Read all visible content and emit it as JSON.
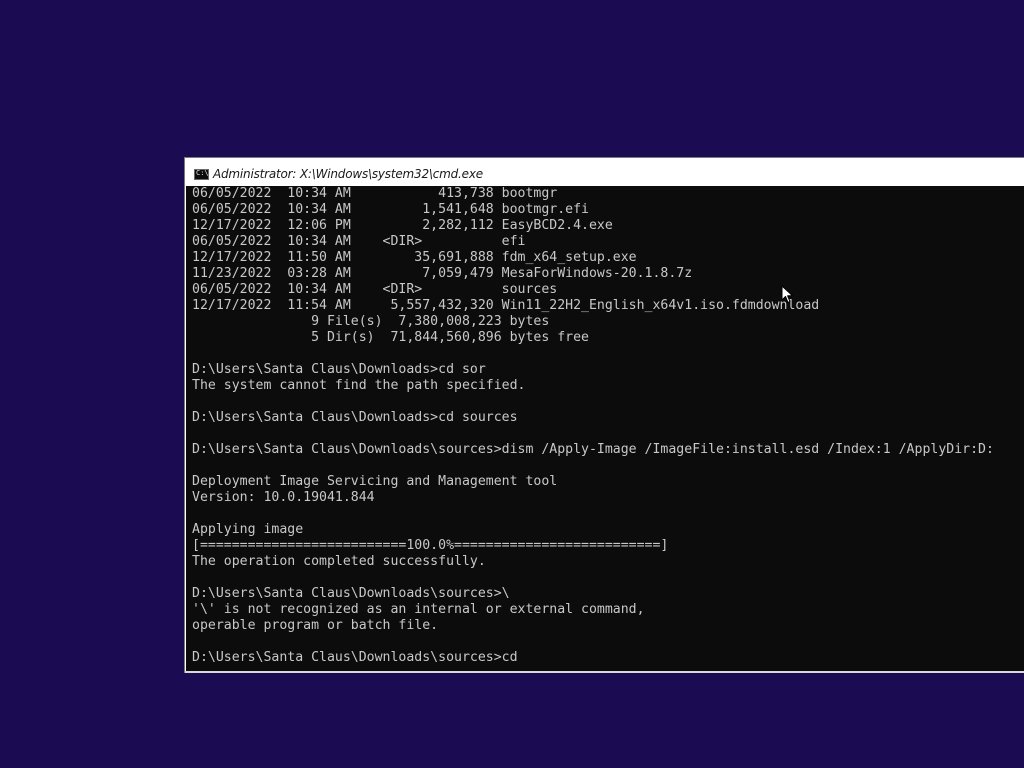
{
  "window": {
    "title": "Administrator: X:\\Windows\\system32\\cmd.exe",
    "icon": "cmd-icon",
    "icon_glyph": "C:\\"
  },
  "console": {
    "lines": [
      "06/05/2022  10:34 AM           413,738 bootmgr",
      "06/05/2022  10:34 AM         1,541,648 bootmgr.efi",
      "12/17/2022  12:06 PM         2,282,112 EasyBCD2.4.exe",
      "06/05/2022  10:34 AM    <DIR>          efi",
      "12/17/2022  11:50 AM        35,691,888 fdm_x64_setup.exe",
      "11/23/2022  03:28 AM         7,059,479 MesaForWindows-20.1.8.7z",
      "06/05/2022  10:34 AM    <DIR>          sources",
      "12/17/2022  11:54 AM     5,557,432,320 Win11_22H2_English_x64v1.iso.fdmdownload",
      "               9 File(s)  7,380,008,223 bytes",
      "               5 Dir(s)  71,844,560,896 bytes free",
      "",
      "D:\\Users\\Santa Claus\\Downloads>cd sor",
      "The system cannot find the path specified.",
      "",
      "D:\\Users\\Santa Claus\\Downloads>cd sources",
      "",
      "D:\\Users\\Santa Claus\\Downloads\\sources>dism /Apply-Image /ImageFile:install.esd /Index:1 /ApplyDir:D:",
      "",
      "Deployment Image Servicing and Management tool",
      "Version: 10.0.19041.844",
      "",
      "Applying image",
      "[==========================100.0%==========================]",
      "The operation completed successfully.",
      "",
      "D:\\Users\\Santa Claus\\Downloads\\sources>\\",
      "'\\' is not recognized as an internal or external command,",
      "operable program or batch file.",
      "",
      "D:\\Users\\Santa Claus\\Downloads\\sources>cd"
    ]
  },
  "colors": {
    "desktop_background": "#1a0b52",
    "console_background": "#0c0c0c",
    "console_text": "#c8c8c8"
  },
  "mouse_cursor": "arrow-cursor-icon"
}
